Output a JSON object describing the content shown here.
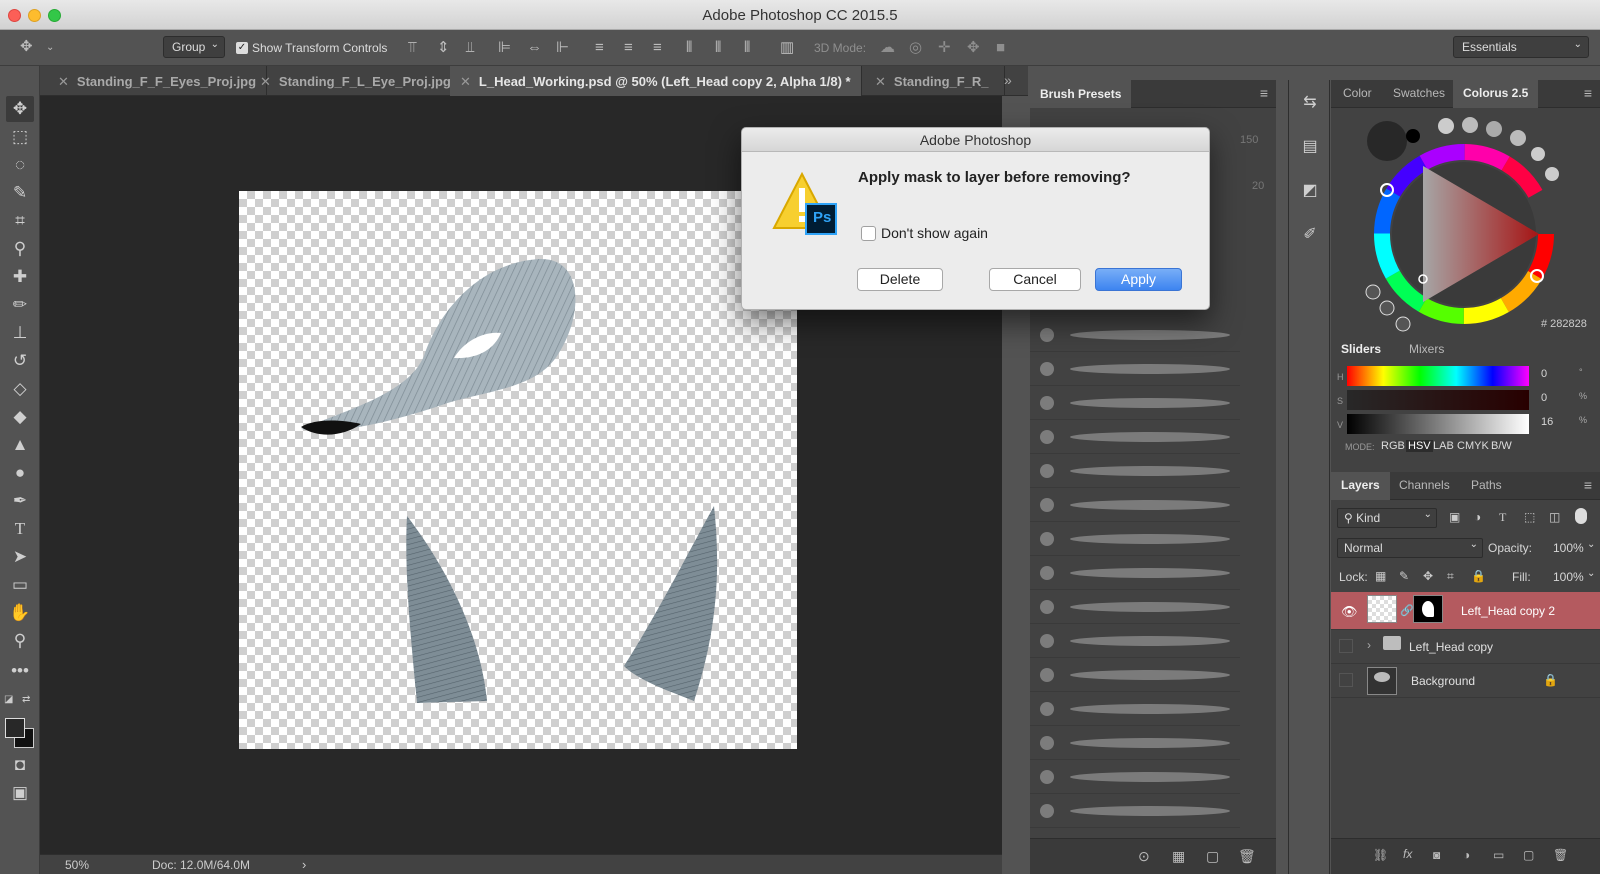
{
  "app": {
    "title": "Adobe Photoshop CC 2015.5"
  },
  "options_bar": {
    "auto_select_value": "Group",
    "show_transform_label": "Show Transform Controls",
    "mode_3d_label": "3D Mode:",
    "workspace_value": "Essentials"
  },
  "tabs": [
    {
      "label": "Standing_F_F_Eyes_Proj.jpg"
    },
    {
      "label": "Standing_F_L_Eye_Proj.jpg"
    },
    {
      "label": "L_Head_Working.psd @ 50% (Left_Head copy 2, Alpha 1/8) *"
    },
    {
      "label": "Standing_F_R_"
    }
  ],
  "status": {
    "zoom": "50%",
    "doc": "Doc: 12.0M/64.0M",
    "arrow": "›"
  },
  "brush_panel": {
    "title": "Brush Presets",
    "sizes": [
      "150",
      "20"
    ]
  },
  "color_panel": {
    "tabs": [
      "Color",
      "Swatches",
      "Colorus 2.5"
    ],
    "hex": "# 282828",
    "subtabs": [
      "Sliders",
      "Mixers"
    ],
    "sliders": [
      {
        "label": "H",
        "value": "0",
        "unit": "°"
      },
      {
        "label": "S",
        "value": "0",
        "unit": "%"
      },
      {
        "label": "V",
        "value": "16",
        "unit": "%"
      }
    ],
    "mode_label": "MODE:",
    "modes": [
      "RGB",
      "HSV",
      "LAB",
      "CMYK",
      "B/W"
    ],
    "foreground_color": "#282828"
  },
  "layers_panel": {
    "tabs": [
      "Layers",
      "Channels",
      "Paths"
    ],
    "filter_value": "Kind",
    "blend_mode": "Normal",
    "opacity_label": "Opacity:",
    "opacity_value": "100%",
    "lock_label": "Lock:",
    "fill_label": "Fill:",
    "fill_value": "100%",
    "layers": [
      {
        "name": "Left_Head copy 2",
        "selected": true,
        "visible": true
      },
      {
        "name": "Left_Head copy",
        "selected": false,
        "visible": false
      },
      {
        "name": "Background",
        "selected": false,
        "visible": false,
        "locked": true
      }
    ]
  },
  "dialog": {
    "title": "Adobe Photoshop",
    "message": "Apply mask to layer before removing?",
    "checkbox_label": "Don't show again",
    "checkbox_checked": false,
    "buttons": {
      "delete": "Delete",
      "cancel": "Cancel",
      "apply": "Apply"
    },
    "icon": "warning-photoshop-icon",
    "ps_badge": "Ps"
  },
  "colors": {
    "accent_blue": "#3d84f0",
    "selected_layer": "#b45a5f",
    "panel_bg": "#424242",
    "app_bg": "#535353"
  }
}
